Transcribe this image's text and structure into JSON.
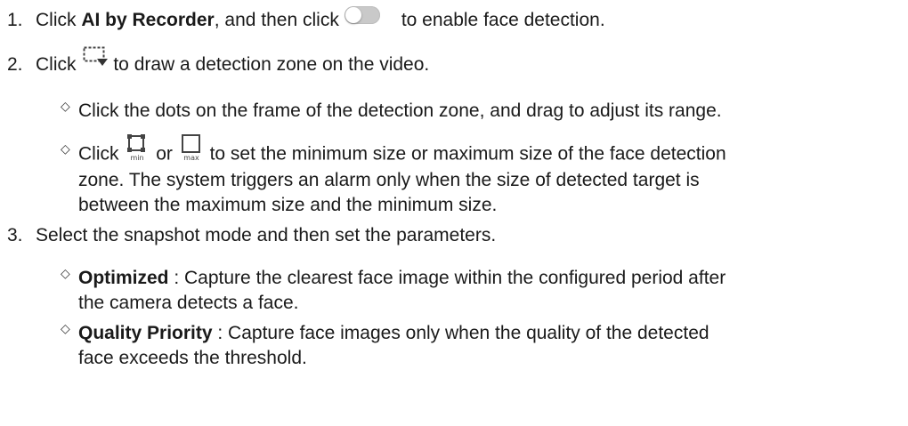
{
  "steps": [
    {
      "number": "1.",
      "t1": "Click ",
      "bold": "AI by Recorder",
      "t2": ", and then click",
      "t3": "to enable face detection."
    },
    {
      "number": "2.",
      "t1": "Click",
      "t2": "to draw a detection zone on the video.",
      "subs": [
        {
          "marker": "◇",
          "text": "Click the dots on the frame of the detection zone, and drag to adjust its range."
        },
        {
          "marker": "◇",
          "t1": "Click",
          "t2": "or",
          "t3": "to set the minimum size or maximum size of the face detection",
          "line2": "zone. The system triggers an alarm only when the size of detected target is",
          "line3": "between the maximum size and the minimum size.",
          "min_label": "min",
          "max_label": "max"
        }
      ]
    },
    {
      "number": "3.",
      "text": "Select the snapshot mode and then set the parameters.",
      "subs": [
        {
          "marker": "◇",
          "bold": "Optimized",
          "text": " : Capture the clearest face image within the configured period after",
          "line2": "the camera detects a face."
        },
        {
          "marker": "◇",
          "bold": "Quality Priority",
          "text": " : Capture face images only when the quality of the detected",
          "line2": "face exceeds the threshold."
        }
      ]
    }
  ],
  "icons": {
    "toggle": "toggle-off-icon",
    "draw_zone": "draw-zone-icon",
    "min_size": "min-size-icon",
    "max_size": "max-size-icon"
  }
}
